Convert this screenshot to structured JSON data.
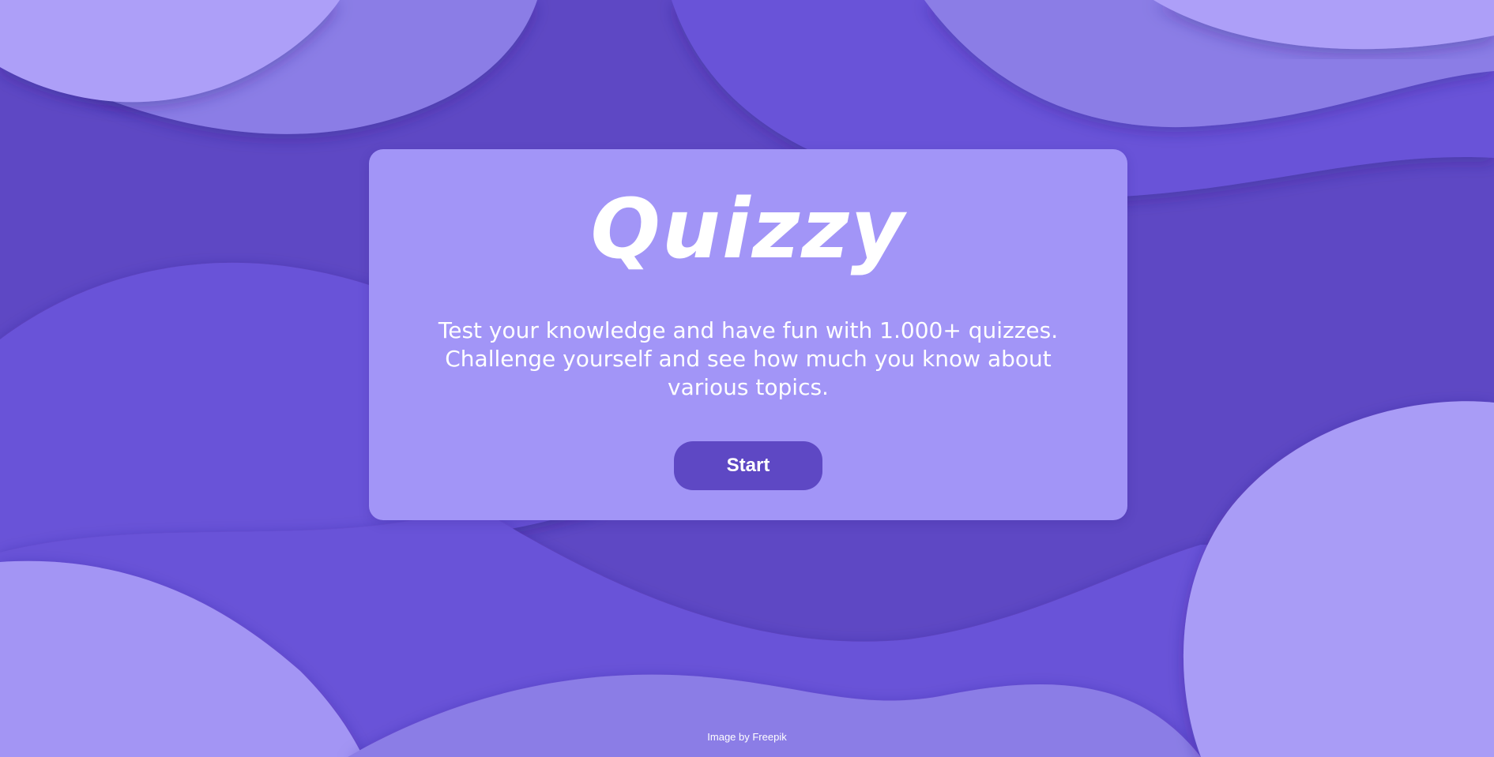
{
  "app": {
    "title": "Quizzy",
    "description": "Test your knowledge and have fun with 1.000+ quizzes. Challenge yourself and see how much you know about various topics.",
    "start_label": "Start"
  },
  "footer": {
    "credit": "Image by Freepik"
  },
  "colors": {
    "background": "#5e48c4",
    "card": "#a295f7",
    "button": "#5e48c4",
    "text": "#ffffff"
  }
}
